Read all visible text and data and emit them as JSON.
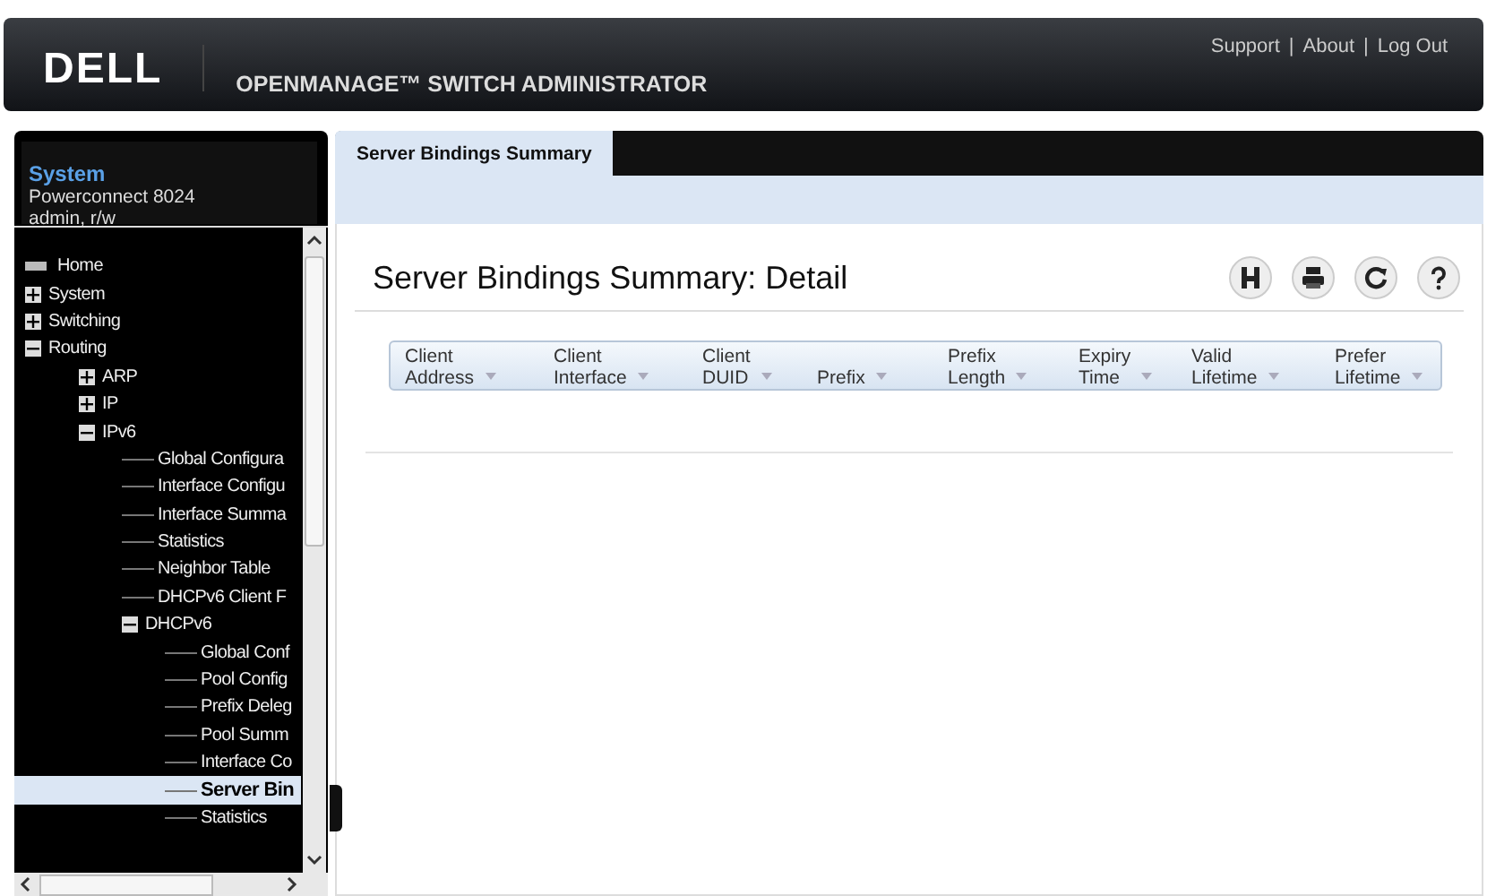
{
  "header": {
    "logo": "DELL",
    "product": "OPENMANAGE™ SWITCH ADMINISTRATOR",
    "links": [
      "Support",
      "About",
      "Log Out"
    ],
    "separator": "|"
  },
  "sidebar": {
    "title": "System",
    "device": "Powerconnect 8024",
    "user": "admin, r/w",
    "tree": [
      {
        "label": "Home",
        "kind": "home",
        "selected": false
      },
      {
        "label": "System",
        "kind": "node",
        "expanded": false,
        "selected": false
      },
      {
        "label": "Switching",
        "kind": "node",
        "expanded": false,
        "selected": false
      },
      {
        "label": "Routing",
        "kind": "node",
        "expanded": true,
        "selected": false,
        "children": [
          {
            "label": "ARP",
            "kind": "node",
            "expanded": false,
            "selected": false
          },
          {
            "label": "IP",
            "kind": "node",
            "expanded": false,
            "selected": false
          },
          {
            "label": "IPv6",
            "kind": "node",
            "expanded": true,
            "selected": false,
            "children": [
              {
                "label": "Global Configura",
                "kind": "leaf",
                "selected": false
              },
              {
                "label": "Interface Configu",
                "kind": "leaf",
                "selected": false
              },
              {
                "label": "Interface Summa",
                "kind": "leaf",
                "selected": false
              },
              {
                "label": "Statistics",
                "kind": "leaf",
                "selected": false
              },
              {
                "label": "Neighbor Table",
                "kind": "leaf",
                "selected": false
              },
              {
                "label": "DHCPv6 Client F",
                "kind": "leaf",
                "selected": false
              },
              {
                "label": "DHCPv6",
                "kind": "node",
                "expanded": true,
                "selected": false,
                "children": [
                  {
                    "label": "Global Conf",
                    "kind": "leaf",
                    "selected": false
                  },
                  {
                    "label": "Pool Config",
                    "kind": "leaf",
                    "selected": false
                  },
                  {
                    "label": "Prefix Deleg",
                    "kind": "leaf",
                    "selected": false
                  },
                  {
                    "label": "Pool Summ",
                    "kind": "leaf",
                    "selected": false
                  },
                  {
                    "label": "Interface Co",
                    "kind": "leaf",
                    "selected": false
                  },
                  {
                    "label": "Server Bin",
                    "kind": "leaf",
                    "selected": true
                  },
                  {
                    "label": "Statistics",
                    "kind": "leaf",
                    "selected": false
                  }
                ]
              }
            ]
          }
        ]
      }
    ]
  },
  "tabs": [
    {
      "label": "Server Bindings Summary",
      "selected": true
    }
  ],
  "page_title": "Server Bindings Summary: Detail",
  "table": {
    "columns": [
      {
        "line1": "Client",
        "line2": "Address"
      },
      {
        "line1": "Client",
        "line2": "Interface"
      },
      {
        "line1": "Client",
        "line2": "DUID"
      },
      {
        "line2": "Prefix"
      },
      {
        "line1": "Prefix",
        "line2": "Length"
      },
      {
        "line1": "Expiry",
        "line2": "Time"
      },
      {
        "line1": "Valid",
        "line2": "Lifetime"
      },
      {
        "line1": "Prefer",
        "line2": "Lifetime"
      }
    ]
  }
}
